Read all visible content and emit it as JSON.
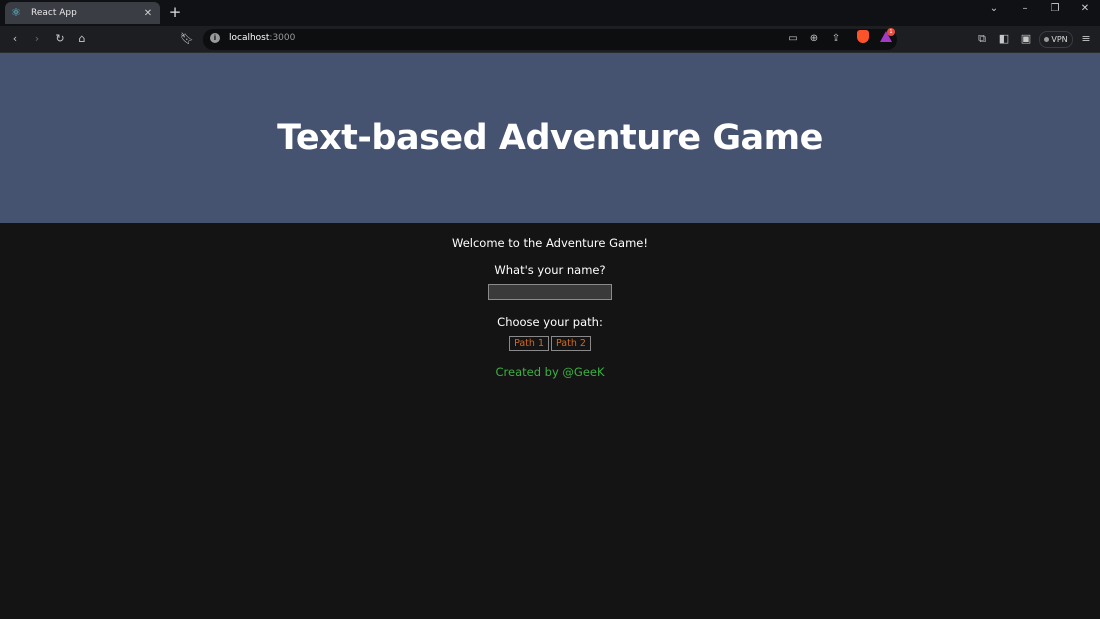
{
  "browser": {
    "tab_title": "React App",
    "new_tab_symbol": "+",
    "url_host": "localhost",
    "url_port": ":3000",
    "vpn_label": "VPN",
    "rewards_count": "1"
  },
  "colors": {
    "hero_bg": "#455371",
    "page_bg": "#141414",
    "path_button_text": "#d2691e",
    "credit_text": "#3cb043"
  },
  "page": {
    "title": "Text-based Adventure Game",
    "welcome": "Welcome to the Adventure Game!",
    "name_question": "What's your name?",
    "name_value": "",
    "choose_path": "Choose your path:",
    "path_buttons": [
      "Path 1",
      "Path 2"
    ],
    "credit": "Created by @GeeK"
  }
}
